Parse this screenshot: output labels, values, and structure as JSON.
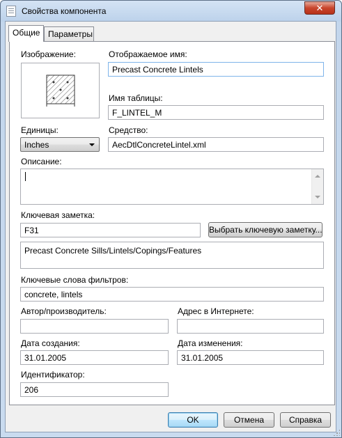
{
  "window": {
    "title": "Свойства компонента"
  },
  "tabs": [
    {
      "label": "Общие",
      "active": true
    },
    {
      "label": "Параметры",
      "active": false
    }
  ],
  "general": {
    "image_label": "Изображение:",
    "display_name_label": "Отображаемое имя:",
    "display_name_value": "Precast Concrete Lintels",
    "table_name_label": "Имя таблицы:",
    "table_name_value": "F_LINTEL_M",
    "units_label": "Единицы:",
    "units_value": "Inches",
    "tool_label": "Средство:",
    "tool_value": "AecDtlConcreteLintel.xml",
    "description_label": "Описание:",
    "description_value": "",
    "keynote_label": "Ключевая заметка:",
    "keynote_value": "F31",
    "keynote_button": "Выбрать ключевую заметку...",
    "keynote_text": "Precast Concrete Sills/Lintels/Copings/Features",
    "filter_keywords_label": "Ключевые слова фильтров:",
    "filter_keywords_value": "concrete, lintels",
    "author_label": "Автор/производитель:",
    "author_value": "",
    "web_address_label": "Адрес в Интернете:",
    "web_address_value": "",
    "created_label": "Дата создания:",
    "created_value": "31.01.2005",
    "modified_label": "Дата изменения:",
    "modified_value": "31.01.2005",
    "id_label": "Идентификатор:",
    "id_value": "206"
  },
  "buttons": {
    "ok": "OK",
    "cancel": "Отмена",
    "help": "Справка"
  },
  "icons": {
    "close": "close-icon",
    "app": "document-icon",
    "units_dropdown": "chevron-down-icon"
  }
}
